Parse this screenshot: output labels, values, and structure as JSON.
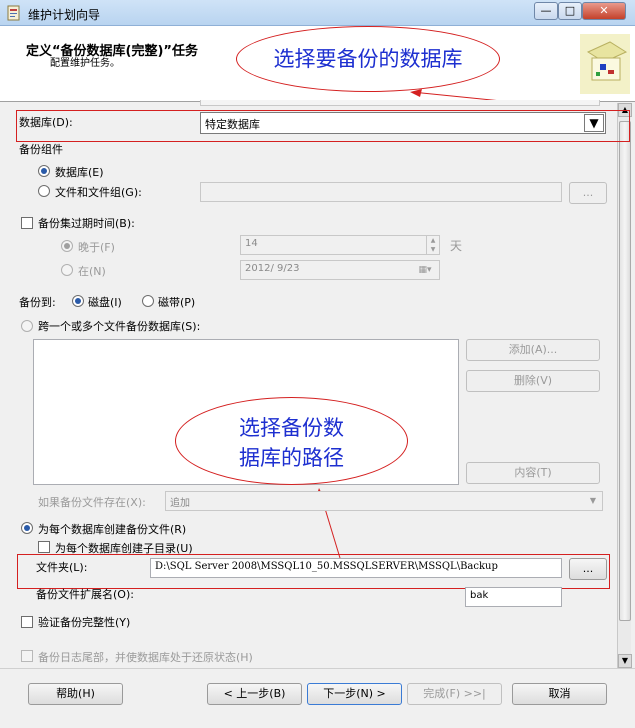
{
  "window": {
    "title": "维护计划向导",
    "minimize": "—",
    "maximize": "□",
    "close": "✕"
  },
  "header": {
    "title": "定义“备份数据库(完整)”任务",
    "subtitle": "配置维护任务。"
  },
  "annotations": {
    "top": "选择要备份的数据库",
    "middle_line1": "选择备份数",
    "middle_line2": "据库的路径"
  },
  "database": {
    "label": "数据库(D):",
    "value": "特定数据库",
    "arrow": "▼"
  },
  "backup_component": {
    "label": "备份组件",
    "option_database": "数据库(E)",
    "option_files": "文件和文件组(G):",
    "browse_label": "..."
  },
  "expire": {
    "label": "备份集过期时间(B):",
    "after_label": "晚于(F)",
    "after_value": "14",
    "after_unit": "天",
    "on_label": "在(N)",
    "on_value": "2012/ 9/23"
  },
  "backup_to": {
    "label": "备份到:",
    "disk": "磁盘(I)",
    "tape": "磁带(P)"
  },
  "span": {
    "label": "跨一个或多个文件备份数据库(S):",
    "add": "添加(A)...",
    "remove": "删除(V)",
    "contents": "内容(T)"
  },
  "if_exists": {
    "label": "如果备份文件存在(X):",
    "value": "追加"
  },
  "per_db": {
    "label": "为每个数据库创建备份文件(R)",
    "subdir": "为每个数据库创建子目录(U)",
    "folder_label": "文件夹(L):",
    "folder_value": "D:\\SQL Server 2008\\MSSQL10_50.MSSQLSERVER\\MSSQL\\Backup",
    "folder_browse": "...",
    "ext_label": "备份文件扩展名(O):",
    "ext_value": "bak"
  },
  "verify": {
    "label": "验证备份完整性(Y)"
  },
  "tail_log": {
    "label": "备份日志尾部，并使数据库处于还原状态(H)"
  },
  "footer": {
    "help": "帮助(H)",
    "back": "< 上一步(B)",
    "next": "下一步(N) >",
    "finish": "完成(F) >>|",
    "cancel": "取消"
  }
}
